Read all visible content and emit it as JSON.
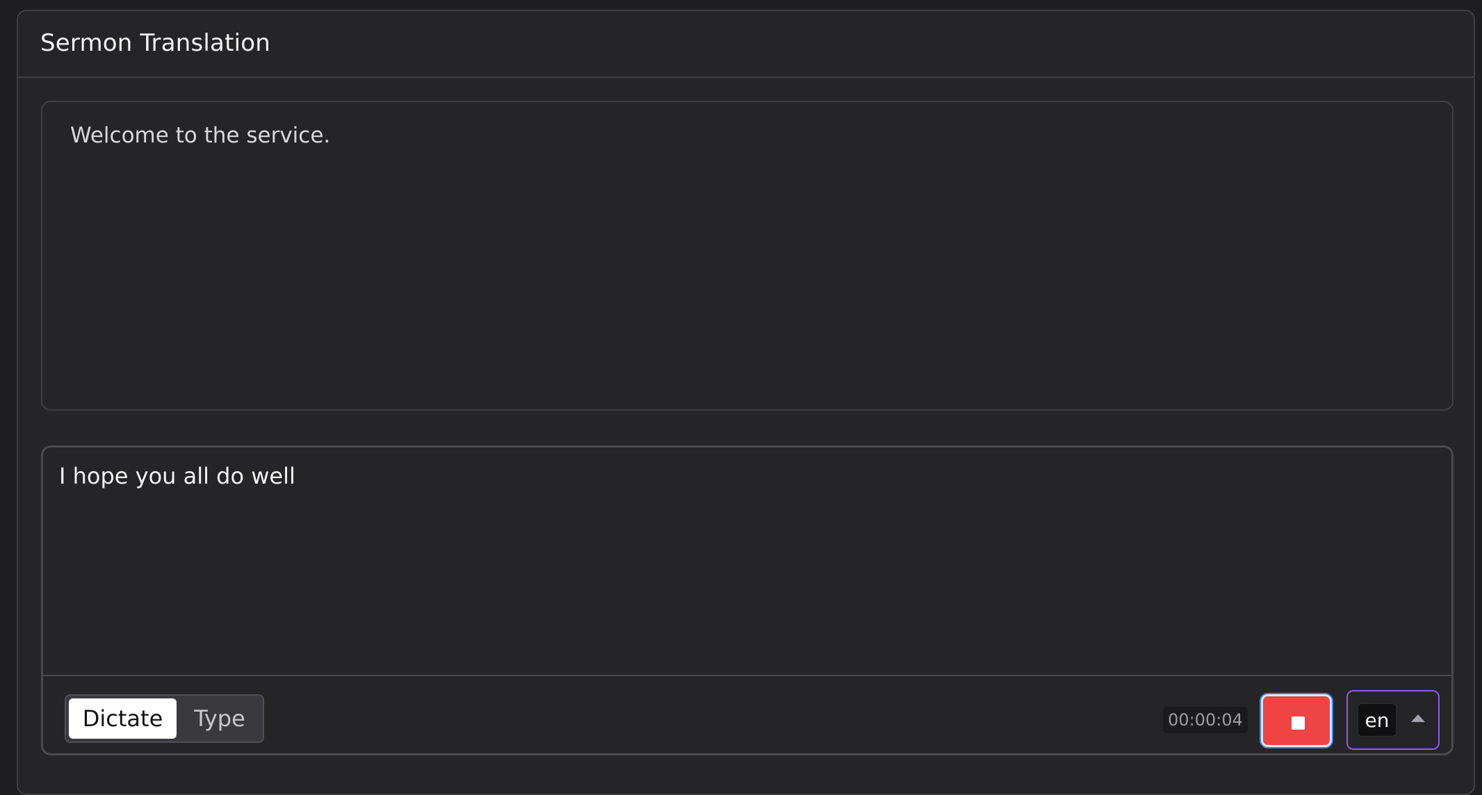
{
  "header": {
    "title": "Sermon Translation"
  },
  "translation": {
    "text": "Welcome to the service."
  },
  "input": {
    "text": "I hope you all do well"
  },
  "toolbar": {
    "modes": {
      "dictate": "Dictate",
      "type": "Type",
      "active": "Dictate"
    },
    "timer": "00:00:04",
    "stop_icon": "stop-icon",
    "language": "en",
    "chevron_icon": "chevron-up-icon"
  },
  "colors": {
    "background": "#1e1e20",
    "panel": "#252527",
    "border": "#3f3f43",
    "stop": "#ef4444",
    "focus_ring": "#3b82f6",
    "language_outline": "#8b5cf6"
  }
}
